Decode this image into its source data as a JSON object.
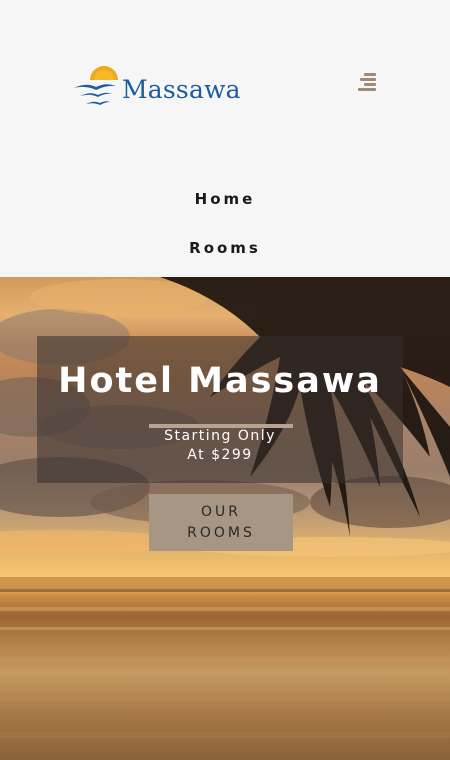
{
  "header": {
    "logo_text": "Massawa",
    "menu_icon": "hamburger-menu-icon"
  },
  "nav": {
    "items": [
      {
        "label": "Home"
      },
      {
        "label": "Rooms"
      }
    ]
  },
  "hero": {
    "title": "Hotel Massawa",
    "subtitle_line1": "Starting Only",
    "subtitle_line2": "At $299",
    "button_line1": "OUR",
    "button_line2": "ROOMS"
  },
  "colors": {
    "background": "#f6f6f6",
    "logo_blue": "#1d5c9c",
    "logo_sun": "#f0a81e",
    "accent_tan": "#a69683"
  }
}
